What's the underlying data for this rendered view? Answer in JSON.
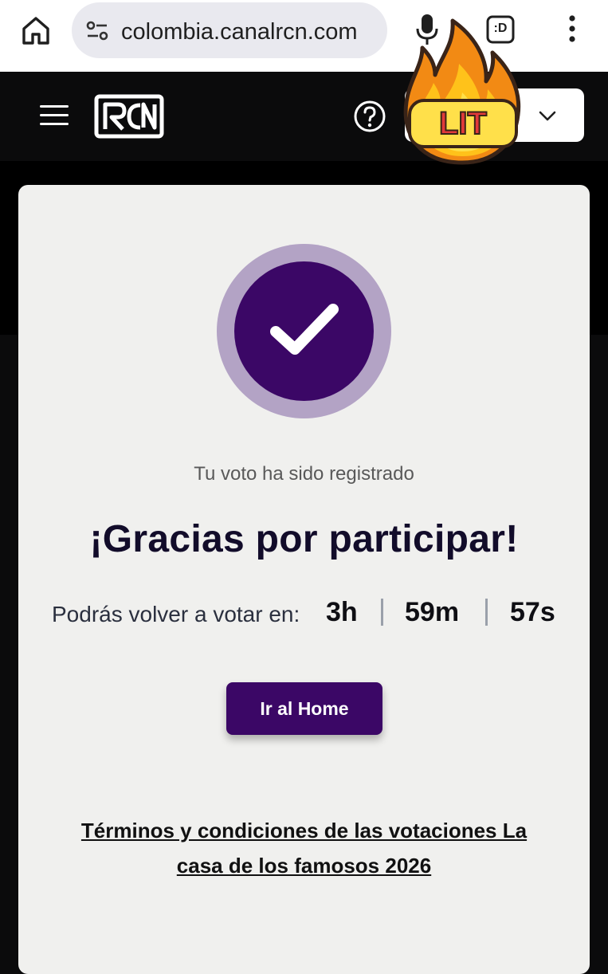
{
  "browser": {
    "url": "colombia.canalrcn.com",
    "tabs_label": ":D"
  },
  "site": {
    "logo_text": "RCN"
  },
  "sticker": {
    "text": "LIT"
  },
  "vote": {
    "subtitle": "Tu voto ha sido registrado",
    "headline": "¡Gracias por participar!",
    "timer_label": "Podrás volver a votar en:",
    "hours": "3h",
    "minutes": "59m",
    "seconds": "57s",
    "home_button": "Ir al Home",
    "terms_line1": "Términos y condiciones de las votaciones La",
    "terms_line2": "casa de los famosos 2026"
  },
  "colors": {
    "accent": "#3b0766",
    "accent_light": "#b3a3c5",
    "header_bg": "#0b0b0c",
    "card_bg": "#f0f0ee"
  }
}
